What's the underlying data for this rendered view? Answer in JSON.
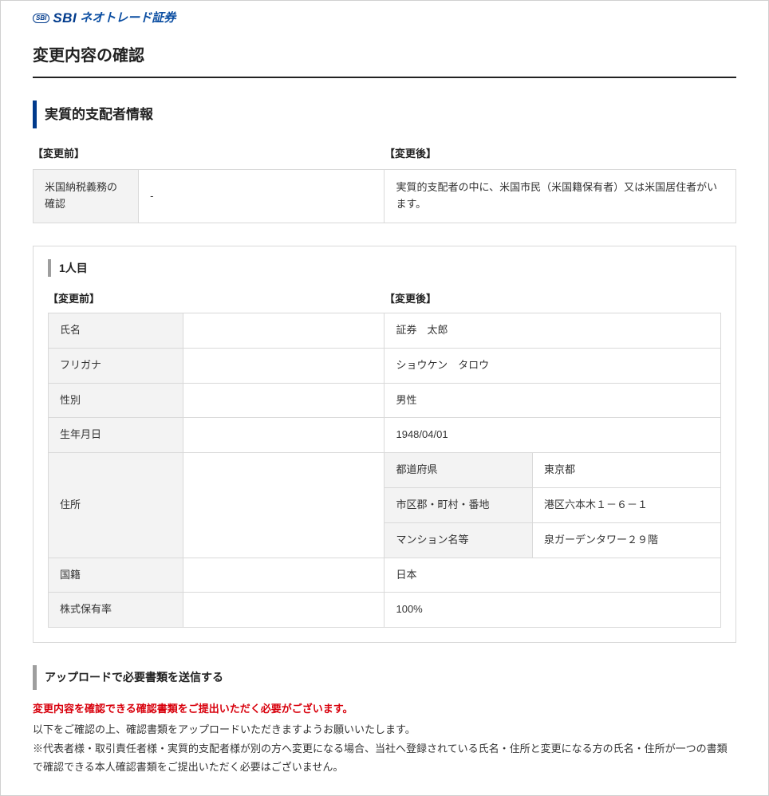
{
  "logo": {
    "mark": "SBI",
    "sbi": "SBI",
    "ja": "ネオトレード証券"
  },
  "page_title": "変更内容の確認",
  "section_title": "実質的支配者情報",
  "header": {
    "before": "【変更前】",
    "after": "【変更後】"
  },
  "us_tax": {
    "label": "米国納税義務の確認",
    "before": "-",
    "after": "実質的支配者の中に、米国市民（米国籍保有者）又は米国居住者がいます。"
  },
  "person": {
    "label": "1人目",
    "rows": {
      "name": {
        "label": "氏名",
        "before": "",
        "after": "証券　太郎"
      },
      "kana": {
        "label": "フリガナ",
        "before": "",
        "after": "ショウケン　タロウ"
      },
      "gender": {
        "label": "性別",
        "before": "",
        "after": "男性"
      },
      "birth": {
        "label": "生年月日",
        "before": "",
        "after": "1948/04/01"
      },
      "address": {
        "label": "住所",
        "before": "",
        "pref": {
          "label": "都道府県",
          "value": "東京都"
        },
        "city": {
          "label": "市区郡・町村・番地",
          "value": "港区六本木１－６－１"
        },
        "bldg": {
          "label": "マンション名等",
          "value": "泉ガーデンタワー２９階"
        }
      },
      "nationality": {
        "label": "国籍",
        "before": "",
        "after": "日本"
      },
      "shares": {
        "label": "株式保有率",
        "before": "",
        "after": "100%"
      }
    }
  },
  "upload": {
    "title": "アップロードで必要書類を送信する",
    "red": "変更内容を確認できる確認書類をご提出いただく必要がございます。",
    "line1": "以下をご確認の上、確認書類をアップロードいただきますようお願いいたします。",
    "line2": "※代表者様・取引責任者様・実質的支配者様が別の方へ変更になる場合、当社へ登録されている氏名・住所と変更になる方の氏名・住所が一つの書類で確認できる本人確認書類をご提出いただく必要はございません。"
  }
}
